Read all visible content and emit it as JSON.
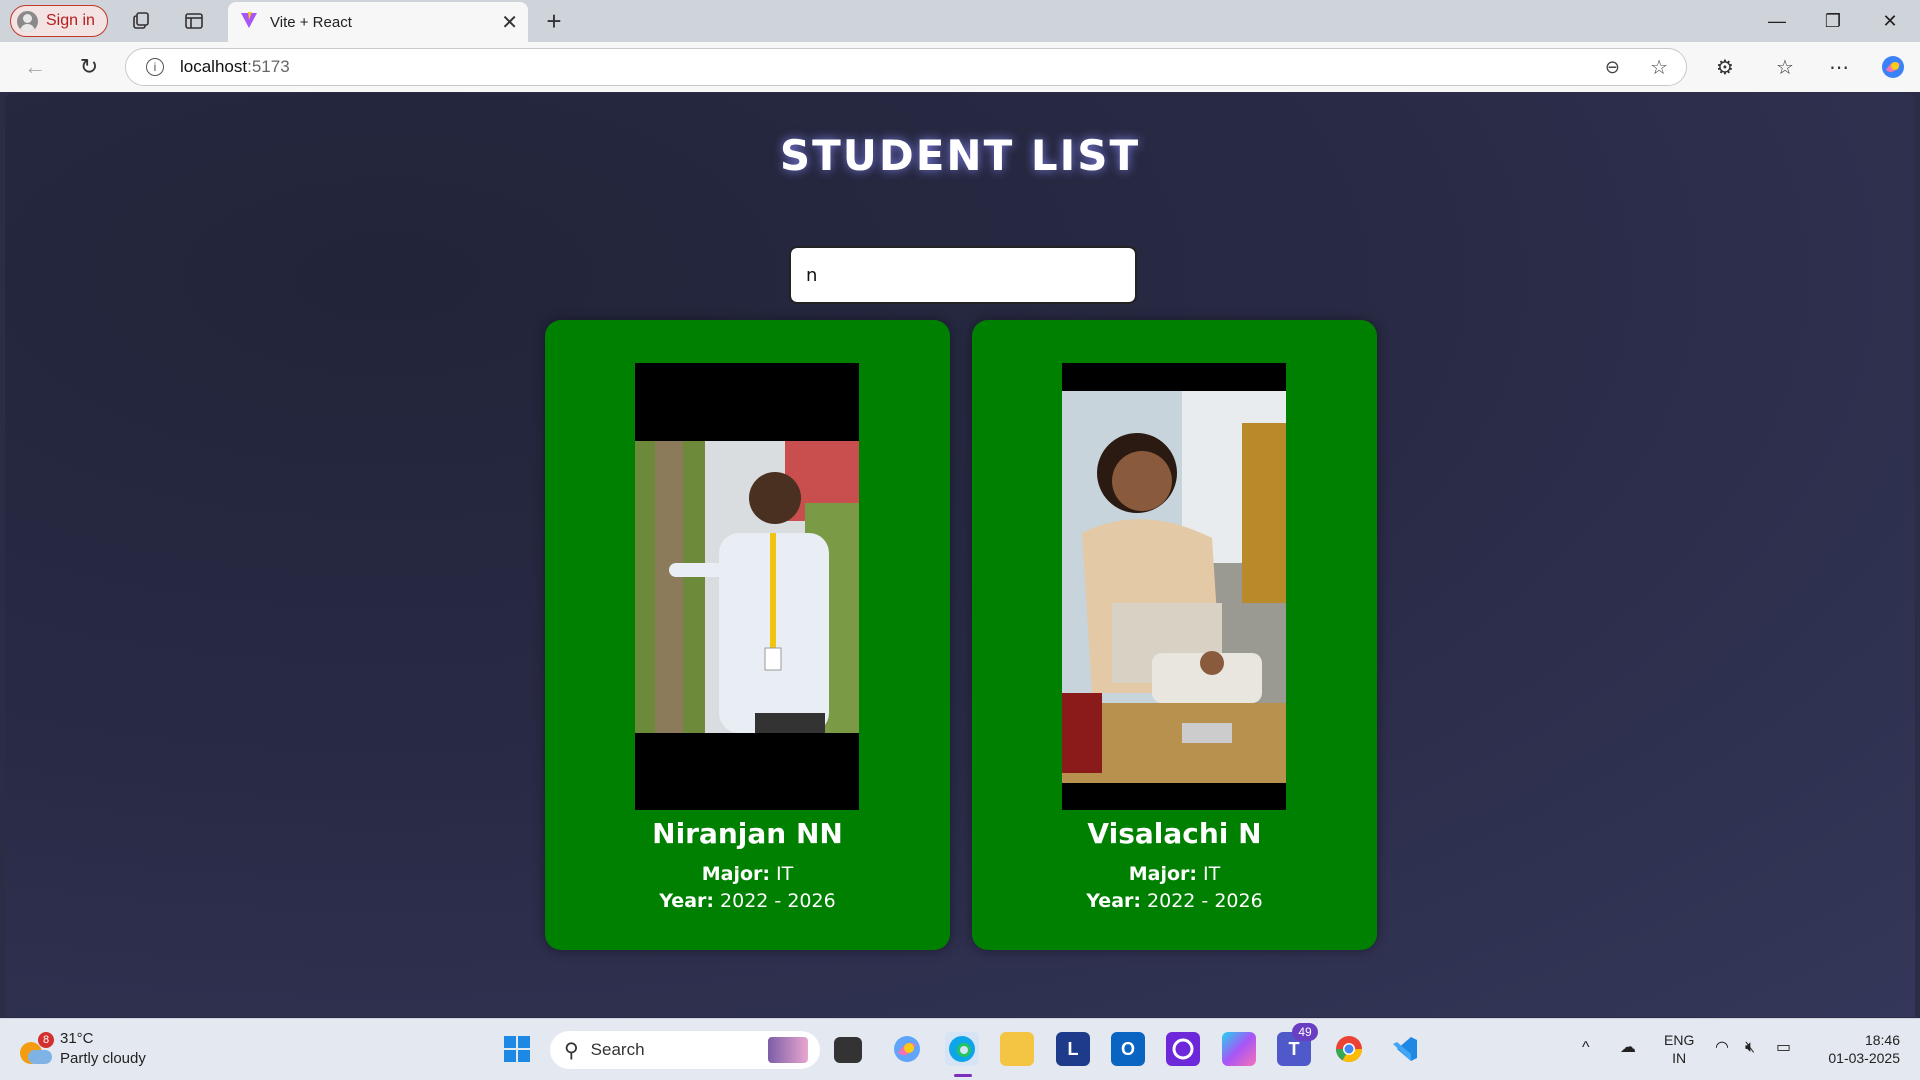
{
  "browser": {
    "signin_label": "Sign in",
    "tab_title": "Vite + React",
    "url_host": "localhost",
    "url_port": ":5173"
  },
  "page": {
    "title": "STUDENT LIST",
    "search_value": "n"
  },
  "students": [
    {
      "name": "Niranjan NN",
      "major_label": "Major:",
      "major": " IT",
      "year_label": "Year:",
      "year": " 2022 - 2026"
    },
    {
      "name": "Visalachi N",
      "major_label": "Major:",
      "major": " IT",
      "year_label": "Year:",
      "year": " 2022 - 2026"
    }
  ],
  "colors": {
    "card_bg": "#008000",
    "page_bg": "#2a2c48",
    "title_glow": "#8c8cff"
  },
  "taskbar": {
    "weather_badge": "8",
    "temperature": "31°C",
    "weather_desc": "Partly cloudy",
    "search_placeholder": "Search",
    "teams_badge": "49",
    "lang_line1": "ENG",
    "lang_line2": "IN",
    "time": "18:46",
    "date": "01-03-2025"
  }
}
